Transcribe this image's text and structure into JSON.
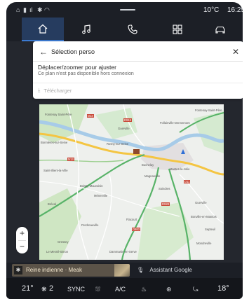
{
  "status": {
    "temperature": "10°C",
    "time": "16:25"
  },
  "nav": {
    "tabs": [
      {
        "name": "home",
        "icon": "home-icon",
        "active": true
      },
      {
        "name": "music",
        "icon": "music-note-icon"
      },
      {
        "name": "phone",
        "icon": "phone-icon"
      },
      {
        "name": "apps",
        "icon": "apps-grid-icon"
      },
      {
        "name": "vehicle",
        "icon": "car-icon"
      }
    ]
  },
  "card": {
    "title": "Sélection perso",
    "instruction": "Déplacer/zoomer pour ajuster",
    "note": "Ce plan n'est pas disponible hors connexion",
    "download_label": "Télécharger"
  },
  "map": {
    "towns": [
      "Fontenay Saint-Père",
      "Fontenay-Saint-Père",
      "Guerville",
      "Follainville-Dennemont",
      "Bonnières-sur-Seine",
      "Rosny-sur-Seine",
      "Bréval",
      "Buchelay",
      "Mantes-la-Jolie",
      "Magnanville",
      "Saint-Illiers-la-Ville",
      "Bréval",
      "Boissy-Mauvoisin",
      "Ménerville",
      "Perdreauville",
      "Soindres",
      "Guerville",
      "Flacourt",
      "Bonville-en-Mantois",
      "Septeuil",
      "Mondreville",
      "Dammartin-en-Serve",
      "Le Mesnil-Simon",
      "Gressey"
    ],
    "road_labels": [
      "D13",
      "D915",
      "D928",
      "N13",
      "D11",
      "D983"
    ]
  },
  "zoom": {
    "in": "+",
    "out": "−"
  },
  "media": {
    "now_playing": "Reine indienne · Meak",
    "assistant": "Assistant Google"
  },
  "climate": {
    "left_temp": "21°",
    "fan_level": "2",
    "sync": "SYNC",
    "ac": "A/C",
    "right_temp": "18°"
  }
}
